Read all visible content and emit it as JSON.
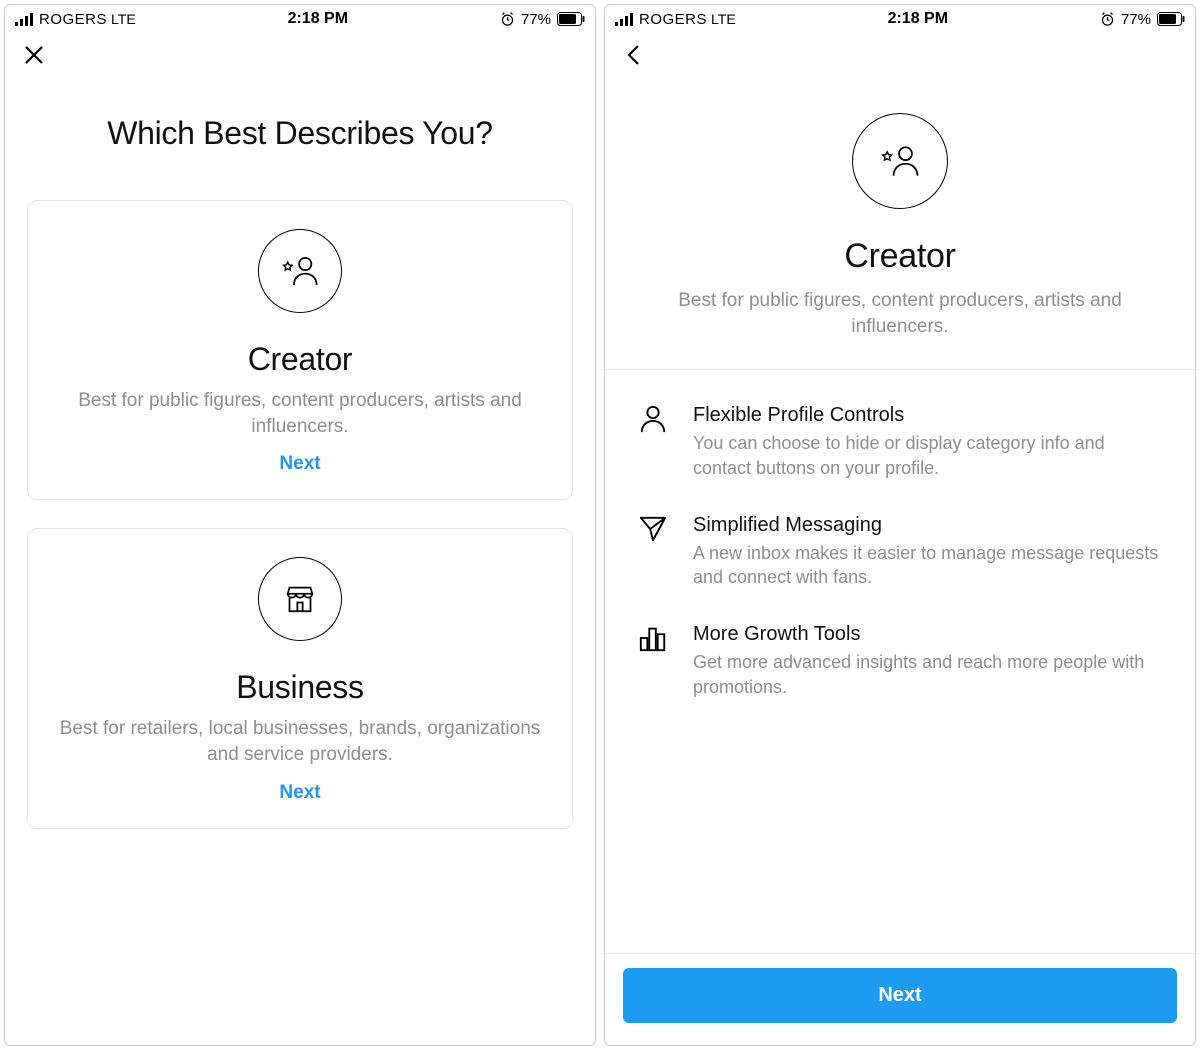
{
  "status": {
    "carrier": "ROGERS",
    "network": "LTE",
    "time": "2:18 PM",
    "battery_pct": "77%"
  },
  "screen1": {
    "title": "Which Best Describes You?",
    "cards": [
      {
        "title": "Creator",
        "desc": "Best for public figures, content producers, artists and influencers.",
        "next_label": "Next",
        "icon": "creator-icon"
      },
      {
        "title": "Business",
        "desc": "Best for retailers, local businesses, brands, organizations and service providers.",
        "next_label": "Next",
        "icon": "storefront-icon"
      }
    ]
  },
  "screen2": {
    "hero_title": "Creator",
    "hero_desc": "Best for public figures, content producers, artists and influencers.",
    "features": [
      {
        "title": "Flexible Profile Controls",
        "desc": "You can choose to hide or display category info and contact buttons on your profile.",
        "icon": "person-icon"
      },
      {
        "title": "Simplified Messaging",
        "desc": "A new inbox makes it easier to manage message requests and connect with fans.",
        "icon": "send-icon"
      },
      {
        "title": "More Growth Tools",
        "desc": "Get more advanced insights and reach more people with promotions.",
        "icon": "bar-chart-icon"
      }
    ],
    "next_label": "Next"
  }
}
